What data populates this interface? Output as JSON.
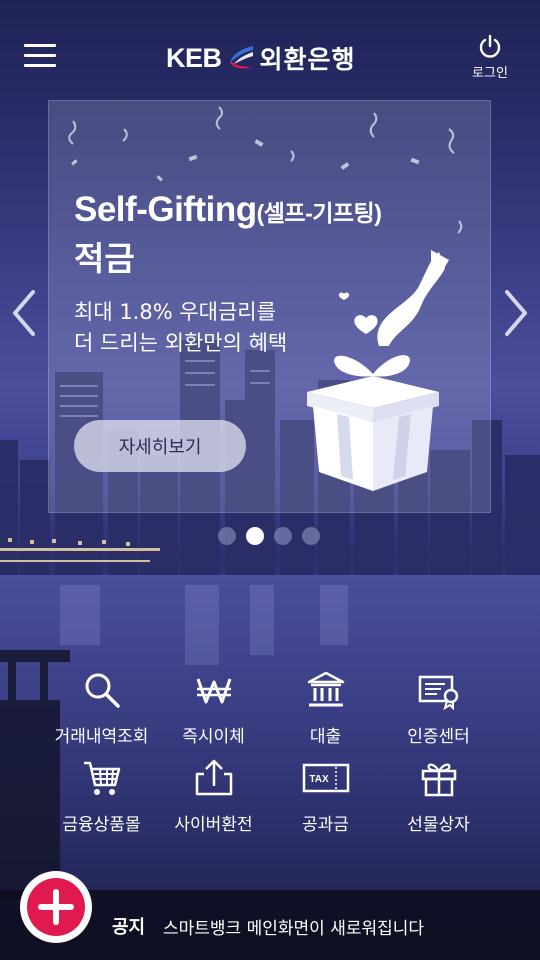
{
  "header": {
    "logo_brand": "KEB",
    "logo_name": "외환은행",
    "login_label": "로그인"
  },
  "banner": {
    "title_en": "Self-Gifting",
    "title_paren": "(셀프-기프팅)",
    "title_ko": "적금",
    "desc_line1": "최대 1.8% 우대금리를",
    "desc_line2": "더 드리는 외환만의 혜택",
    "button_label": "자세히보기",
    "slide_count": 4,
    "active_slide": 2
  },
  "quick_menu": [
    {
      "label": "거래내역조회",
      "icon": "search-icon"
    },
    {
      "label": "즉시이체",
      "icon": "won-icon"
    },
    {
      "label": "대출",
      "icon": "bank-icon"
    },
    {
      "label": "인증센터",
      "icon": "certificate-icon"
    },
    {
      "label": "금융상품몰",
      "icon": "cart-icon"
    },
    {
      "label": "사이버환전",
      "icon": "exchange-icon"
    },
    {
      "label": "공과금",
      "icon": "tax-icon",
      "icon_text": "TAX"
    },
    {
      "label": "선물상자",
      "icon": "gift-icon"
    }
  ],
  "notice": {
    "title": "공지",
    "text": "스마트뱅크 메인화면이 새로워집니다"
  },
  "colors": {
    "accent": "#e0194f",
    "background_top": "#1f2356",
    "background_mid": "#4b4f9a",
    "notice_bg": "#0c0c1c"
  }
}
